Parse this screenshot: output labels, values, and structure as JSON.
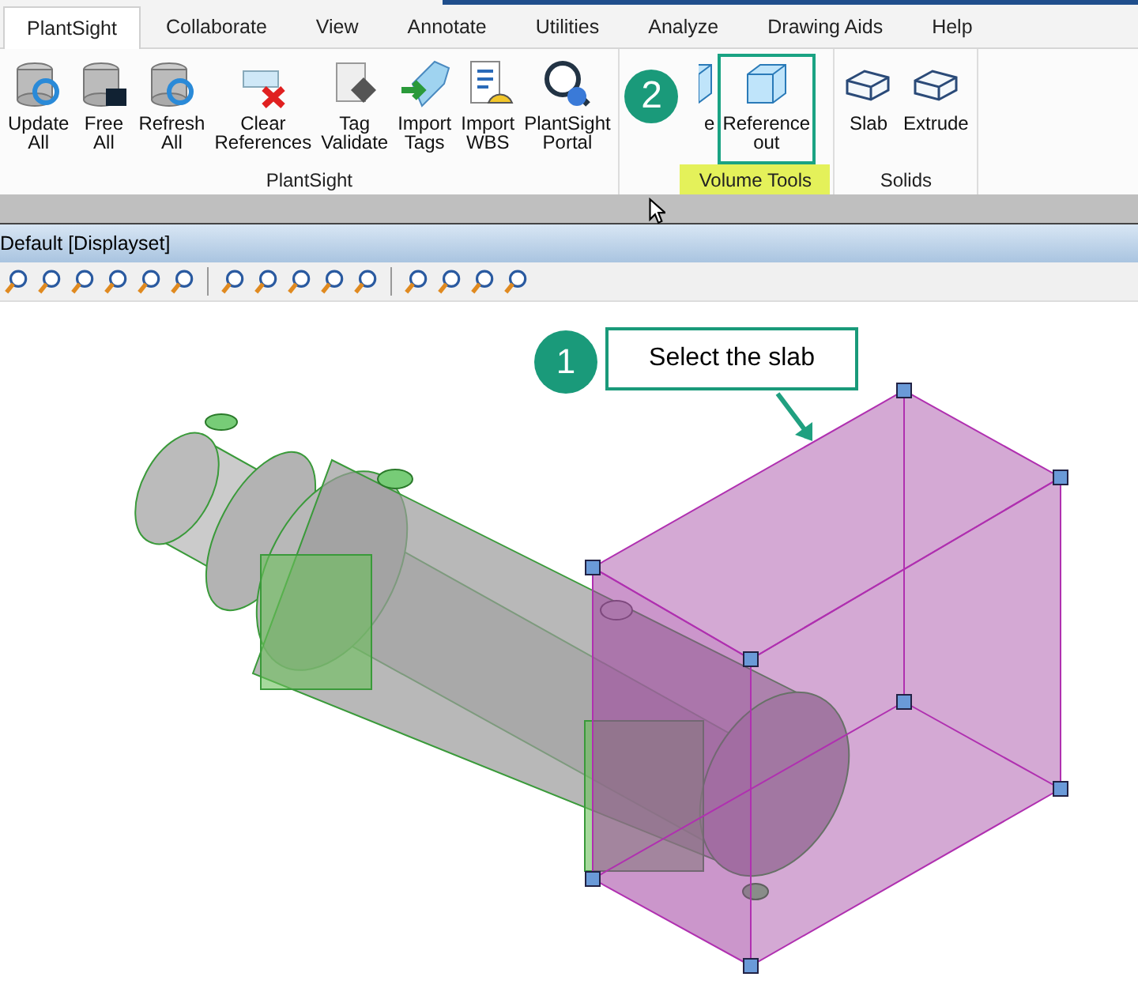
{
  "tabs": [
    {
      "label": "PlantSight",
      "selected": true
    },
    {
      "label": "Collaborate",
      "selected": false
    },
    {
      "label": "View",
      "selected": false
    },
    {
      "label": "Annotate",
      "selected": false
    },
    {
      "label": "Utilities",
      "selected": false
    },
    {
      "label": "Analyze",
      "selected": false
    },
    {
      "label": "Drawing Aids",
      "selected": false
    },
    {
      "label": "Help",
      "selected": false
    }
  ],
  "ribbon_groups": [
    {
      "label": "PlantSight",
      "highlighted": false,
      "buttons": [
        {
          "lines": [
            "Update",
            "All"
          ],
          "highlighted": false,
          "covered": false
        },
        {
          "lines": [
            "Free",
            "All"
          ],
          "highlighted": false,
          "covered": false
        },
        {
          "lines": [
            "Refresh",
            "All"
          ],
          "highlighted": false,
          "covered": false
        },
        {
          "lines": [
            "Clear",
            "References"
          ],
          "highlighted": false,
          "covered": false
        },
        {
          "lines": [
            "Tag",
            "Validate"
          ],
          "highlighted": false,
          "covered": false
        },
        {
          "lines": [
            "Import",
            "Tags"
          ],
          "highlighted": false,
          "covered": false
        },
        {
          "lines": [
            "Import",
            "WBS"
          ],
          "highlighted": false,
          "covered": false
        },
        {
          "lines": [
            "PlantSight",
            "Portal"
          ],
          "highlighted": false,
          "covered": false
        }
      ]
    },
    {
      "label": "Volume Tools",
      "highlighted": true,
      "badge": "2",
      "buttons": [
        {
          "lines": [
            "e"
          ],
          "highlighted": false,
          "covered": true
        },
        {
          "lines": [
            "Reference",
            "out"
          ],
          "highlighted": true,
          "covered": false
        }
      ]
    },
    {
      "label": "Solids",
      "highlighted": false,
      "buttons": [
        {
          "lines": [
            "Slab"
          ],
          "highlighted": false,
          "covered": false
        },
        {
          "lines": [
            "Extrude"
          ],
          "highlighted": false,
          "covered": false
        }
      ]
    }
  ],
  "view_title": "Default [Displayset]",
  "callout": {
    "badge": "1",
    "text": "Select the slab"
  }
}
